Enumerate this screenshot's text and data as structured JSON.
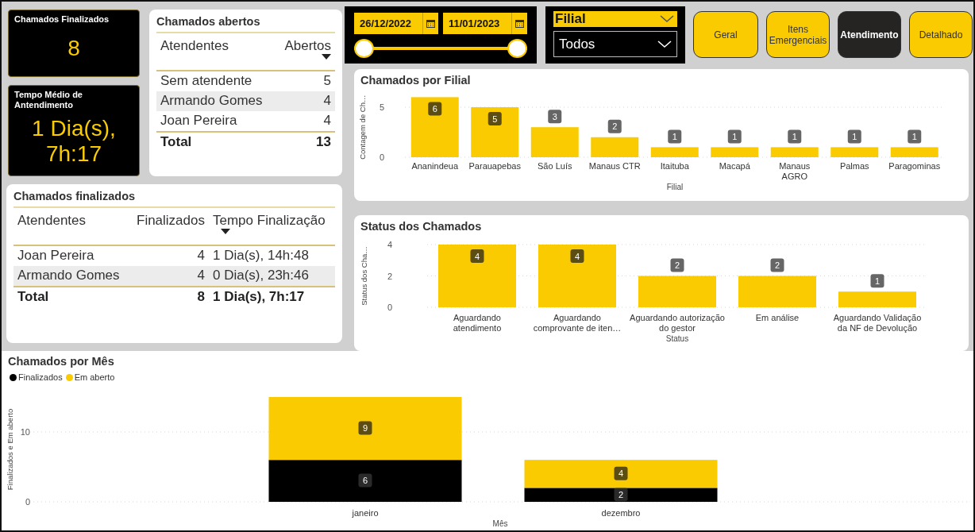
{
  "kpis": [
    {
      "title": "Chamados Finalizados",
      "value": "8"
    },
    {
      "title": "Tempo Médio de Antendimento",
      "value": "1 Dia(s), 7h:17"
    }
  ],
  "open_table": {
    "title": "Chamados abertos",
    "columns": [
      {
        "label": "Atendentes",
        "sorted": false
      },
      {
        "label": "Abertos",
        "sorted": true
      }
    ],
    "rows": [
      [
        "Sem atendente",
        "5"
      ],
      [
        "Armando Gomes",
        "4"
      ],
      [
        "Joan Pereira",
        "4"
      ]
    ],
    "total": [
      "Total",
      "13"
    ]
  },
  "closed_table": {
    "title": "Chamados finalizados",
    "columns": [
      {
        "label": "Atendentes",
        "sorted": false
      },
      {
        "label": "Finalizados",
        "sorted": false
      },
      {
        "label": "Tempo Finalização",
        "sorted": true
      }
    ],
    "rows": [
      [
        "Joan Pereira",
        "4",
        "1 Dia(s), 14h:48"
      ],
      [
        "Armando Gomes",
        "4",
        "0 Dia(s), 23h:46"
      ]
    ],
    "total": [
      "Total",
      "8",
      "1 Dia(s), 7h:17"
    ]
  },
  "date_range": {
    "start": "26/12/2022",
    "end": "11/01/2023"
  },
  "filter": {
    "label": "Filial",
    "value": "Todos"
  },
  "nav_buttons": [
    {
      "label": "Geral",
      "selected": false
    },
    {
      "label": "Itens Emergenciais",
      "selected": false
    },
    {
      "label": "Atendimento",
      "selected": true
    },
    {
      "label": "Detalhado",
      "selected": false
    }
  ],
  "branch_chart": {
    "title": "Chamados por Filial",
    "chart_data": {
      "type": "bar",
      "xlabel": "Filial",
      "ylabel": "Contagem de Ch…",
      "categories": [
        "Ananindeua",
        "Parauapebas",
        "São Luís",
        "Manaus CTR",
        "Itaituba",
        "Macapá",
        "Manaus AGRO",
        "Palmas",
        "Paragominas"
      ],
      "values": [
        6,
        5,
        3,
        2,
        1,
        1,
        1,
        1,
        1
      ],
      "ylim": [
        0,
        6
      ],
      "yticks": [
        0,
        5
      ],
      "data_labels": true
    }
  },
  "status_chart": {
    "title": "Status dos Chamados",
    "chart_data": {
      "type": "bar",
      "xlabel": "Status",
      "ylabel": "Status dos Cha…",
      "categories": [
        "Aguardando atendimento",
        "Aguardando comprovante de iten…",
        "Aguardando autorização do gestor",
        "Em análise",
        "Aguardando Validação da NF de Devolução"
      ],
      "values": [
        4,
        4,
        2,
        2,
        1
      ],
      "ylim": [
        0,
        4
      ],
      "yticks": [
        0,
        2,
        4
      ],
      "data_labels": true
    }
  },
  "month_chart": {
    "title": "Chamados por Mês",
    "chart_data": {
      "type": "bar",
      "stacked": true,
      "xlabel": "Mês",
      "ylabel": "Finalizados e Em aberto",
      "categories": [
        "janeiro",
        "dezembro"
      ],
      "ylim": [
        0,
        15
      ],
      "yticks": [
        0,
        10
      ],
      "data_labels": true,
      "legend": "top-left",
      "series": [
        {
          "name": "Finalizados",
          "color": "#000000",
          "values": [
            6,
            2
          ]
        },
        {
          "name": "Em aberto",
          "color": "#f9cb00",
          "values": [
            9,
            4
          ]
        }
      ]
    }
  }
}
